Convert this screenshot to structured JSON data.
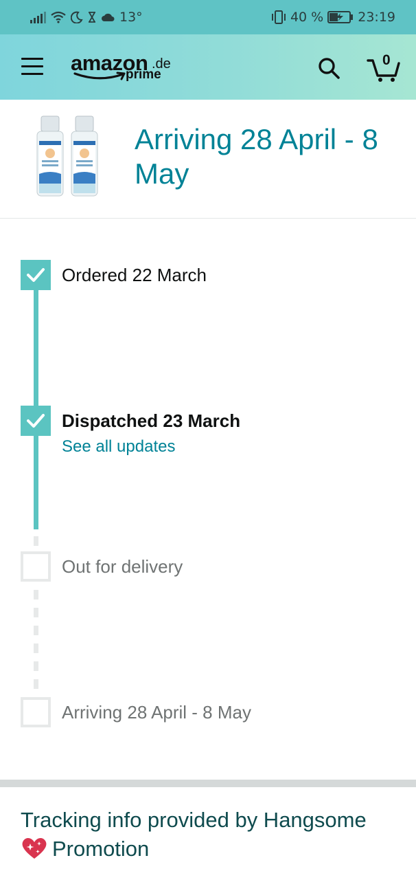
{
  "status_bar": {
    "temperature": "13°",
    "battery": "40 %",
    "time": "23:19",
    "icons": [
      "signal-icon",
      "wifi-icon",
      "moon-icon",
      "hourglass-icon",
      "cloud-icon",
      "vibrate-icon",
      "battery-charging-icon"
    ]
  },
  "header": {
    "logo_main": "amazon",
    "logo_suffix": ".de",
    "logo_sub": "prime",
    "cart_count": "0",
    "icons": [
      "menu-icon",
      "search-icon",
      "cart-icon"
    ]
  },
  "product": {
    "arrival_title": "Arriving 28 April - 8 May"
  },
  "timeline": {
    "steps": [
      {
        "label": "Ordered 22 March",
        "done": true
      },
      {
        "label": "Dispatched 23 March",
        "done": true,
        "link": "See all updates"
      },
      {
        "label": "Out for delivery",
        "done": false
      },
      {
        "label": "Arriving 28 April - 8 May",
        "done": false
      }
    ]
  },
  "footer": {
    "tracking_info": "Tracking info provided by Hangsome",
    "provider_name": "Promotion"
  },
  "colors": {
    "accent": "#5bc4c1",
    "link": "#008296",
    "header_gradient_start": "#7fd5dc",
    "header_gradient_end": "#a6e6d3"
  }
}
